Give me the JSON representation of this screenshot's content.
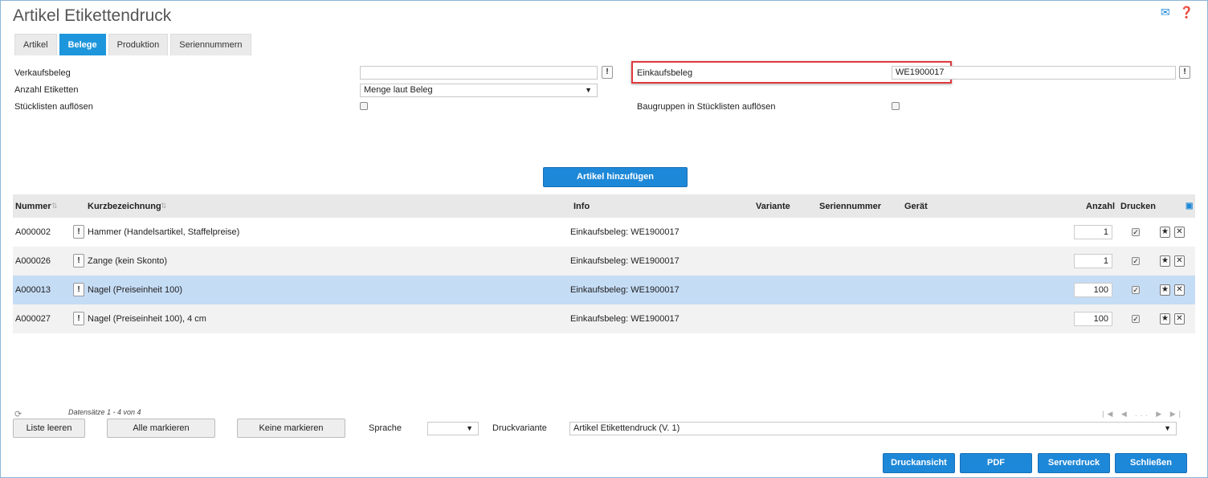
{
  "title": "Artikel Etikettendruck",
  "icons": {
    "mail": "mail-icon",
    "help": "help-icon"
  },
  "tabs": [
    {
      "label": "Artikel",
      "active": false
    },
    {
      "label": "Belege",
      "active": true
    },
    {
      "label": "Produktion",
      "active": false
    },
    {
      "label": "Seriennummern",
      "active": false
    }
  ],
  "form": {
    "verkaufsbeleg_label": "Verkaufsbeleg",
    "verkaufsbeleg_value": "",
    "anzahl_label": "Anzahl Etiketten",
    "anzahl_value": "Menge laut Beleg",
    "stueckliste_label": "Stücklisten auflösen",
    "einkaufsbeleg_label": "Einkaufsbeleg",
    "einkaufsbeleg_value": "WE1900017",
    "baugruppen_label": "Baugruppen in Stücklisten auflösen",
    "info_btn": "!"
  },
  "add_button": "Artikel hinzufügen",
  "columns": {
    "nummer": "Nummer",
    "kurz": "Kurzbezeichnung",
    "info": "Info",
    "variante": "Variante",
    "seriennummer": "Seriennummer",
    "geraet": "Gerät",
    "anzahl": "Anzahl",
    "drucken": "Drucken"
  },
  "rows": [
    {
      "nummer": "A000002",
      "kurz": "Hammer (Handelsartikel, Staffelpreise)",
      "info": "Einkaufsbeleg: WE1900017",
      "anzahl": "1",
      "selected": false
    },
    {
      "nummer": "A000026",
      "kurz": "Zange (kein Skonto)",
      "info": "Einkaufsbeleg: WE1900017",
      "anzahl": "1",
      "selected": false
    },
    {
      "nummer": "A000013",
      "kurz": "Nagel (Preiseinheit 100)",
      "info": "Einkaufsbeleg: WE1900017",
      "anzahl": "100",
      "selected": true
    },
    {
      "nummer": "A000027",
      "kurz": "Nagel (Preiseinheit 100), 4 cm",
      "info": "Einkaufsbeleg: WE1900017",
      "anzahl": "100",
      "selected": false
    }
  ],
  "footer": {
    "records": "Datensätze 1 - 4 von 4",
    "liste_leeren": "Liste leeren",
    "alle_markieren": "Alle markieren",
    "keine_markieren": "Keine markieren",
    "sprache_label": "Sprache",
    "sprache_value": "",
    "druckvariante_label": "Druckvariante",
    "druckvariante_value": "Artikel Etikettendruck (V. 1)",
    "pager": "|◀ ◀ ... ▶ ▶|"
  },
  "actions": {
    "druckansicht": "Druckansicht",
    "pdf": "PDF",
    "serverdruck": "Serverdruck",
    "schliessen": "Schließen"
  },
  "colors": {
    "accent": "#1e88d8",
    "selected_row": "#c5dcf5",
    "highlight": "#e0393e"
  }
}
